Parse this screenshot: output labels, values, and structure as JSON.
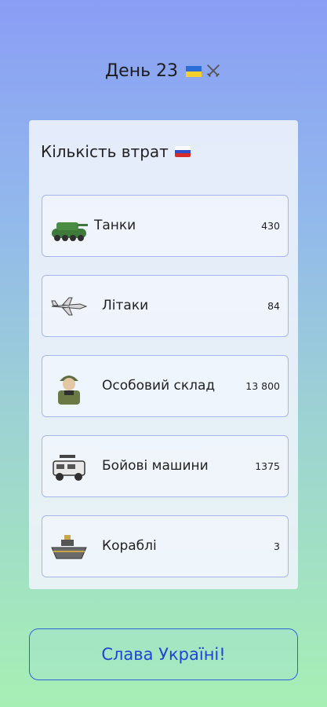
{
  "header": {
    "title": "День 23",
    "flag_icon": "ukraine-flag-icon",
    "extra_icon": "crossed-swords-icon"
  },
  "panel": {
    "title": "Кількість втрат",
    "title_icon": "russia-flag-icon",
    "items": [
      {
        "icon": "tank-icon",
        "label": "Танки",
        "value": "430"
      },
      {
        "icon": "airplane-icon",
        "label": "Літаки",
        "value": "84"
      },
      {
        "icon": "soldier-icon",
        "label": "Особовий склад",
        "value": "13 800"
      },
      {
        "icon": "armored-vehicle-icon",
        "label": "Бойові машини",
        "value": "1375"
      },
      {
        "icon": "ship-icon",
        "label": "Кораблі",
        "value": "3"
      }
    ]
  },
  "footer": {
    "button_label": "Слава Україні!"
  },
  "colors": {
    "accent_blue": "#1f44d6",
    "card_border": "#a7b5ee",
    "ua_blue": "#2b6fd6",
    "ua_yellow": "#f3d02b"
  }
}
